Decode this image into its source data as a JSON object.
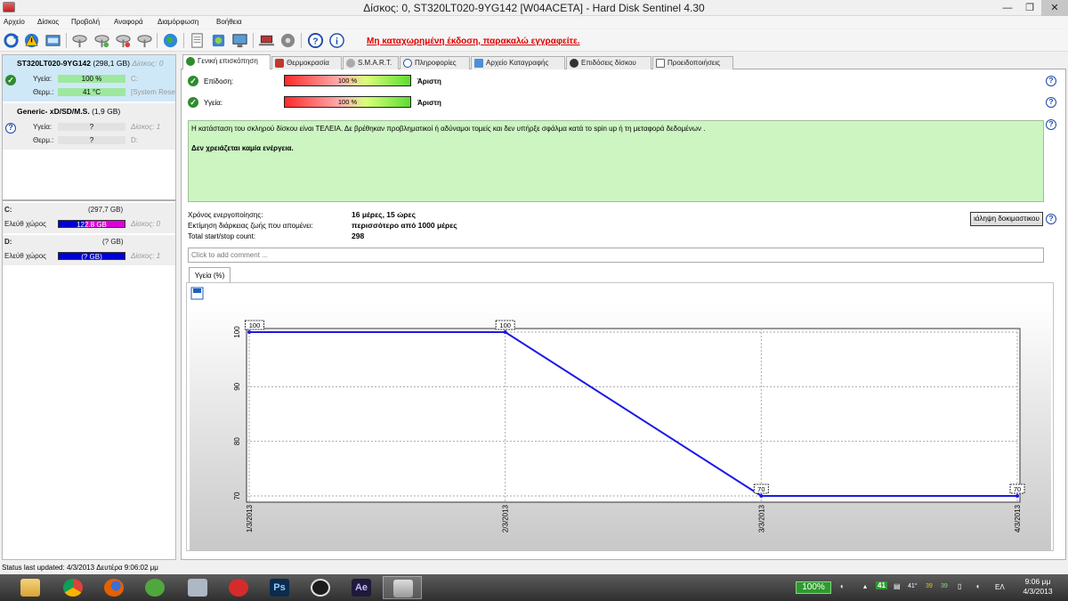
{
  "window": {
    "title": "Δίσκος: 0, ST320LT020-9YG142 [W04ACETA]  -  Hard Disk Sentinel 4.30",
    "min": "—",
    "max": "❐",
    "close": "✕"
  },
  "menu": [
    "Αρχείο",
    "Δίσκος",
    "Προβολή",
    "Αναφορά",
    "Διαμόρφωση",
    "Βοήθεια"
  ],
  "toolbar": {
    "unregistered_text": "Μη καταχωρημένη έκδοση, παρακαλώ εγγραφείτε."
  },
  "left_panel": {
    "disks": [
      {
        "name": "ST320LT020-9YG142",
        "size": "(298,1 GB)",
        "disk_label": "Δίσκος: 0",
        "health_label": "Υγεία:",
        "health_value": "100 %",
        "health_extra": "C:",
        "temp_label": "Θερμ.:",
        "temp_value": "41 °C",
        "temp_extra": "[System Rese"
      },
      {
        "name": "Generic- xD/SD/M.S.",
        "size": "(1,9 GB)",
        "disk_label": "Δίσκος: 1",
        "health_label": "Υγεία:",
        "health_value": "?",
        "temp_label": "Θερμ.:",
        "temp_value": "?",
        "temp_extra": "D:"
      }
    ],
    "volumes": [
      {
        "name": "C:",
        "size": "(297,7 GB)",
        "free_label": "Ελεύθ χώρος",
        "free_value": "122.8 GB",
        "free_fraction": 0.41,
        "disk_label": "Δίσκος: 0"
      },
      {
        "name": "D:",
        "size": "(? GB)",
        "free_label": "Ελεύθ χώρος",
        "free_value": "(? GB)",
        "disk_label": "Δίσκος: 1"
      }
    ]
  },
  "tabs": [
    {
      "label": "Γενική επισκόπηση",
      "icon": "check-icon",
      "active": true
    },
    {
      "label": "Θερμοκρασία",
      "icon": "thermometer-icon"
    },
    {
      "label": "S.M.A.R.T.",
      "icon": "disk-icon"
    },
    {
      "label": "Πληροφορίες",
      "icon": "info-icon"
    },
    {
      "label": "Αρχείο Καταγραφής",
      "icon": "log-icon"
    },
    {
      "label": "Επιδόσεις δίσκου",
      "icon": "performance-icon"
    },
    {
      "label": "Προειδοποιήσεις",
      "icon": "alerts-icon"
    }
  ],
  "overview": {
    "performance_label": "Επίδοση:",
    "performance_value": "100 %",
    "performance_rating": "Άριστη",
    "health_label": "Υγεία:",
    "health_value": "100 %",
    "health_rating": "Άριστη",
    "status_text": "Η κατάσταση του σκληρού δίσκου είναι ΤΕΛΕΙΑ. Δε βρέθηκαν προβληματικοί ή αδύναμοι τομείς και δεν υπήρξε σφάλμα κατά το spin up ή τη μεταφορά δεδομένων .",
    "action_text": "Δεν χρειάζεται καμία ενέργεια.",
    "power_on_label": "Χρόνος ενεργοποίησης:",
    "power_on_value": "16 μέρες, 15 ώρες",
    "lifetime_label": "Εκτίμηση διάρκειας ζωής που απομένει:",
    "lifetime_value": "περισσότερο από 1000 μέρες",
    "startstop_label": "Total start/stop count:",
    "startstop_value": "298",
    "test_button": "ιάληψη δοκιμαστικου",
    "comment_placeholder": "Click to add comment ...",
    "chart_tab": "Υγεία (%)"
  },
  "chart_data": {
    "type": "line",
    "x": [
      "1/3/2013",
      "2/3/2013",
      "3/3/2013",
      "4/3/2013"
    ],
    "series": [
      {
        "values": [
          100,
          100,
          70,
          70
        ],
        "color": "#1a1ae6"
      }
    ],
    "ylim": [
      70,
      100
    ],
    "yticks": [
      70,
      80,
      90,
      100
    ],
    "grid": true,
    "point_labels": [
      "100",
      "100",
      "70",
      "70"
    ]
  },
  "statusbar": {
    "text": "Status last updated: 4/3/2013 Δευτέρα 9:06:02 μμ"
  },
  "taskbar": {
    "apps": [
      "file-explorer-icon",
      "chrome-icon",
      "firefox-icon",
      "utorrent-icon",
      "calculator-icon",
      "download-icon",
      "photoshop-icon",
      "steam-icon",
      "after-effects-icon",
      "hard-disk-sentinel-icon"
    ],
    "battery": "100%",
    "tray_temp1": "41",
    "tray_temp2": "41°",
    "tray_temp3": "39",
    "tray_temp4": "39",
    "language": "ΕΛ",
    "time": "9:06 μμ",
    "date": "4/3/2013"
  }
}
